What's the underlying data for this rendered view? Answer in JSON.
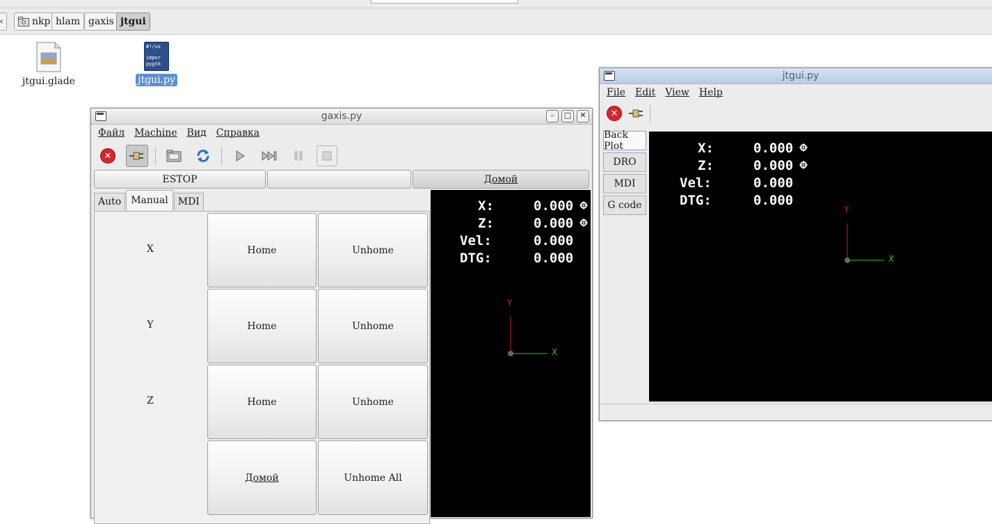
{
  "file_manager": {
    "breadcrumbs": [
      "nkp",
      "hlam",
      "gaxis",
      "jtgui"
    ],
    "active_crumb": "jtgui",
    "files": [
      {
        "name": "jtgui.glade",
        "icon": "glade-file-icon"
      },
      {
        "name": "jtgui.py",
        "icon": "python-script-icon",
        "preview": [
          "#!/us",
          "impor",
          "pygtk"
        ],
        "selected": true
      }
    ]
  },
  "gaxis_window": {
    "title": "gaxis.py",
    "menu": [
      "Файл",
      "Machine",
      "Вид",
      "Справка"
    ],
    "toolbar_icons": [
      "estop-icon",
      "power-icon",
      "open-file-icon",
      "reload-icon",
      "run-icon",
      "step-icon",
      "pause-icon",
      "stop-icon"
    ],
    "estop_label": "ESTOP",
    "middle_button_label": "",
    "home_all_label": "Домой",
    "tabs": [
      "Auto",
      "Manual",
      "MDI"
    ],
    "active_tab": "Manual",
    "axes": [
      {
        "axis": "X",
        "home": "Home",
        "unhome": "Unhome"
      },
      {
        "axis": "Y",
        "home": "Home",
        "unhome": "Unhome"
      },
      {
        "axis": "Z",
        "home": "Home",
        "unhome": "Unhome"
      }
    ],
    "home_all_button": "Домой",
    "unhome_all_button": "Unhome All",
    "dro": [
      {
        "label": "X:",
        "value": "0.000"
      },
      {
        "label": "Z:",
        "value": "0.000"
      },
      {
        "label": "Vel:",
        "value": "0.000"
      },
      {
        "label": "DTG:",
        "value": "0.000"
      }
    ],
    "plot_axes": {
      "y": "Y",
      "x": "X"
    }
  },
  "jtgui_window": {
    "title": "jtgui.py",
    "menu": [
      "File",
      "Edit",
      "View",
      "Help"
    ],
    "side_tabs": [
      "Back Plot",
      "DRO",
      "MDI",
      "G code"
    ],
    "active_side_tab": "Back Plot",
    "dro": [
      {
        "label": "X:",
        "value": "0.000"
      },
      {
        "label": "Z:",
        "value": "0.000"
      },
      {
        "label": "Vel:",
        "value": "0.000"
      },
      {
        "label": "DTG:",
        "value": "0.000"
      }
    ],
    "plot_axes": {
      "y": "Y",
      "x": "X"
    }
  },
  "colors": {
    "estop_red": "#d7262a",
    "x_axis": "#22cc22",
    "y_axis": "#cc2222",
    "dro_bg": "#000000",
    "selection": "#5f8fd0"
  }
}
